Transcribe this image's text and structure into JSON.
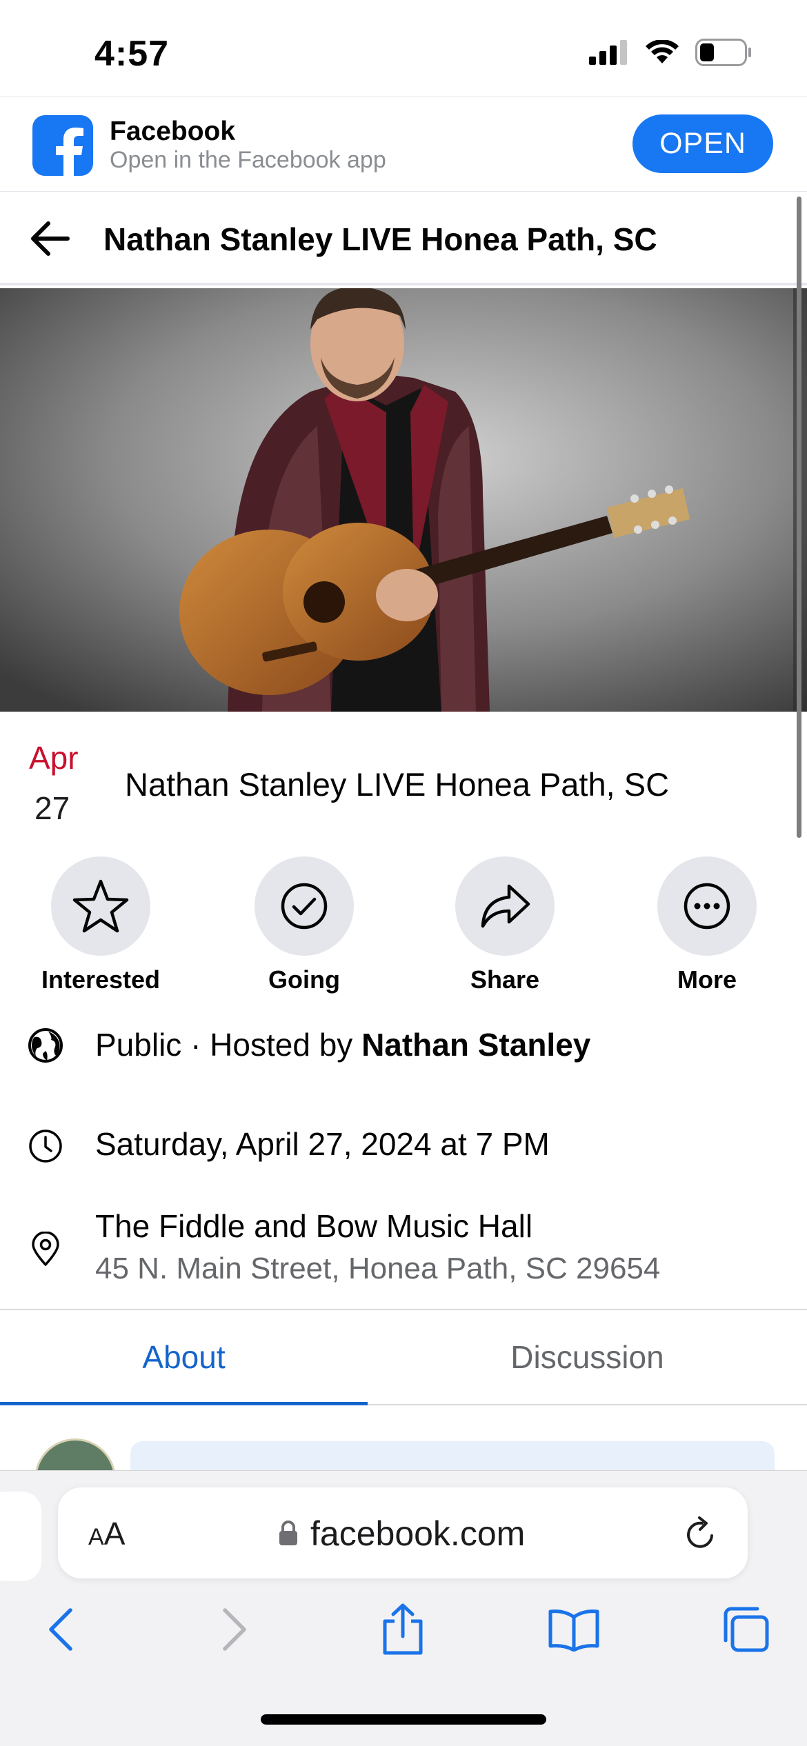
{
  "status_bar": {
    "time": "4:57"
  },
  "app_banner": {
    "app_name": "Facebook",
    "subtitle": "Open in the Facebook app",
    "open_label": "OPEN"
  },
  "header": {
    "title": "Nathan Stanley LIVE Honea Path, SC"
  },
  "event": {
    "month": "Apr",
    "day": "27",
    "title": "Nathan Stanley LIVE Honea Path, SC"
  },
  "actions": [
    {
      "label": "Interested",
      "icon": "star-icon"
    },
    {
      "label": "Going",
      "icon": "check-circle-icon"
    },
    {
      "label": "Share",
      "icon": "share-arrow-icon"
    },
    {
      "label": "More",
      "icon": "more-dots-icon"
    }
  ],
  "details": {
    "privacy_prefix": "Public · Hosted by ",
    "host": "Nathan Stanley",
    "datetime": "Saturday, April 27, 2024 at 7 PM",
    "venue": "The Fiddle and Bow Music Hall",
    "address": "45 N. Main Street, Honea Path, SC 29654"
  },
  "tabs": [
    {
      "label": "About",
      "active": true
    },
    {
      "label": "Discussion",
      "active": false
    }
  ],
  "browser": {
    "text_size_label_small": "A",
    "text_size_label_large": "A",
    "url": "facebook.com"
  },
  "colors": {
    "facebook_blue": "#1877f2",
    "active_tab": "#1464cc",
    "date_red": "#c8102e"
  }
}
